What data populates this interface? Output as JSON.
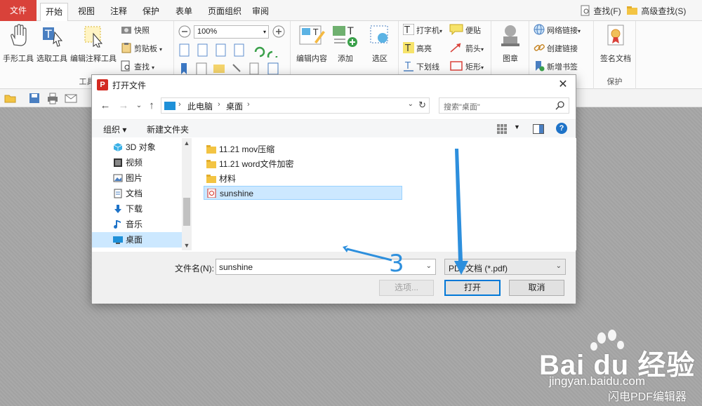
{
  "ribbon": {
    "tabs": [
      "文件",
      "开始",
      "视图",
      "注释",
      "保护",
      "表单",
      "页面组织",
      "审阅"
    ],
    "search_label": "查找(F)",
    "adv_search_label": "高级查找(S)",
    "tools": {
      "hand": "手形工具",
      "select": "选取工具",
      "edit_annot": "编辑注释工具",
      "snapshot": "快照",
      "clipboard": "剪贴板",
      "find": "查找",
      "zoom": "100%",
      "edit_content": "编辑内容",
      "add": "添加",
      "select_area": "选区",
      "typewriter": "打字机",
      "highlight": "高亮",
      "underline": "下划线",
      "note": "便贴",
      "arrow": "箭头",
      "rect": "矩形",
      "image": "图章",
      "weblink": "网络链接",
      "create_link": "创建链接",
      "bookmark": "新增书签",
      "sign": "签名文档"
    },
    "group_labels": {
      "tools": "工具",
      "protect": "保护"
    }
  },
  "dialog": {
    "title": "打开文件",
    "close": "✕",
    "breadcrumb": [
      "此电脑",
      "桌面"
    ],
    "search_placeholder": "搜索\"桌面\"",
    "organize": "组织 ▾",
    "new_folder": "新建文件夹",
    "help": "?",
    "nav_items": [
      {
        "label": "3D 对象",
        "icon": "cube-icon"
      },
      {
        "label": "视频",
        "icon": "video-icon"
      },
      {
        "label": "图片",
        "icon": "picture-icon"
      },
      {
        "label": "文档",
        "icon": "document-icon"
      },
      {
        "label": "下载",
        "icon": "download-icon"
      },
      {
        "label": "音乐",
        "icon": "music-icon"
      },
      {
        "label": "桌面",
        "icon": "desktop-icon"
      }
    ],
    "files": [
      {
        "name": "11.21 mov压缩",
        "type": "folder"
      },
      {
        "name": "11.21 word文件加密",
        "type": "folder"
      },
      {
        "name": "材料",
        "type": "folder"
      },
      {
        "name": "sunshine",
        "type": "pdf"
      }
    ],
    "filename_label": "文件名(N):",
    "filename_value": "sunshine",
    "filetype_value": "PDF文档 (*.pdf)",
    "options_button": "选项...",
    "open_button": "打开",
    "cancel_button": "取消"
  },
  "annotation": {
    "step_number": "3",
    "color": "#2d8fdd"
  },
  "watermark": {
    "brand": "Bai du 经验",
    "url": "jingyan.baidu.com",
    "app": "闪电PDF编辑器"
  }
}
